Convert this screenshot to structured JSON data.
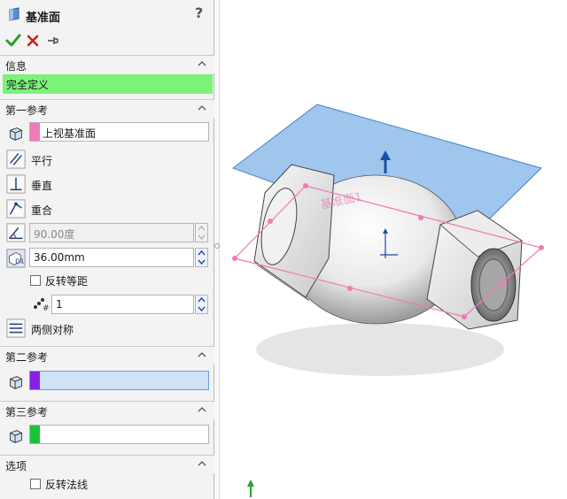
{
  "panel": {
    "title": "基准面",
    "help_label": "?",
    "actions": {
      "ok": "check-icon",
      "cancel": "close-icon",
      "pin": "pin-icon"
    },
    "info": {
      "header": "信息",
      "message": "完全定义"
    },
    "first_ref": {
      "header": "第一参考",
      "selection": "上视基准面",
      "swatch_color": "#f07ab8",
      "constraints": {
        "parallel": "平行",
        "perpendicular": "垂直",
        "coincident": "重合"
      },
      "angle_value": "90.00度",
      "distance_value": "36.00mm",
      "flip_offset_label": "反转等距",
      "instances_value": "1",
      "mid_plane_label": "两侧对称"
    },
    "second_ref": {
      "header": "第二参考",
      "selection": "",
      "swatch_color": "#8a1ee6"
    },
    "third_ref": {
      "header": "第三参考",
      "selection": "",
      "swatch_color": "#19c43c"
    },
    "options": {
      "header": "选项",
      "flip_normal_label": "反转法线"
    }
  },
  "viewport": {
    "plane_label": "基准面1",
    "colors": {
      "plane": "#7fb3e6",
      "preview": "#f07ab8",
      "arrow": "#1a4fa8"
    }
  }
}
